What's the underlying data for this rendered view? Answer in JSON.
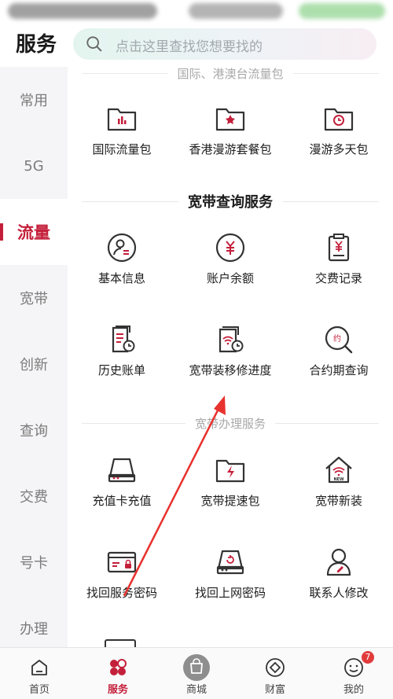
{
  "header": {
    "title": "服务",
    "search_placeholder": "点击这里查找您想要找的"
  },
  "sidebar": {
    "items": [
      {
        "label": "常用"
      },
      {
        "label": "5G"
      },
      {
        "label": "流量",
        "active": true
      },
      {
        "label": "宽带"
      },
      {
        "label": "创新"
      },
      {
        "label": "查询"
      },
      {
        "label": "交费"
      },
      {
        "label": "号卡"
      },
      {
        "label": "办理"
      }
    ]
  },
  "sections": {
    "roaming": {
      "title": "国际、港澳台流量包",
      "items": [
        {
          "label": "国际流量包",
          "icon": "folder-chart-icon"
        },
        {
          "label": "香港漫游套餐包",
          "icon": "folder-flower-icon"
        },
        {
          "label": "漫游多天包",
          "icon": "folder-clock-icon"
        }
      ]
    },
    "broadband_query": {
      "title": "宽带查询服务",
      "items": [
        {
          "label": "基本信息",
          "icon": "user-info-icon"
        },
        {
          "label": "账户余额",
          "icon": "yen-coin-icon"
        },
        {
          "label": "交费记录",
          "icon": "clipboard-yen-icon"
        },
        {
          "label": "历史账单",
          "icon": "bill-clock-icon"
        },
        {
          "label": "宽带装移修进度",
          "icon": "wifi-clock-icon"
        },
        {
          "label": "合约期查询",
          "icon": "contract-search-icon"
        }
      ]
    },
    "broadband_service": {
      "title": "宽带办理服务",
      "items": [
        {
          "label": "充值卡充值",
          "icon": "router-icon"
        },
        {
          "label": "宽带提速包",
          "icon": "folder-bolt-icon"
        },
        {
          "label": "宽带新装",
          "icon": "house-wifi-icon"
        },
        {
          "label": "找回服务密码",
          "icon": "card-lock-icon"
        },
        {
          "label": "找回上网密码",
          "icon": "router-refresh-icon"
        },
        {
          "label": "联系人修改",
          "icon": "contact-edit-icon"
        }
      ]
    }
  },
  "tabbar": {
    "items": [
      {
        "label": "首页",
        "icon": "home-icon"
      },
      {
        "label": "服务",
        "icon": "service-icon",
        "active": true
      },
      {
        "label": "商城",
        "icon": "shop-bag-icon"
      },
      {
        "label": "财富",
        "icon": "diamond-icon"
      },
      {
        "label": "我的",
        "icon": "profile-icon",
        "badge": "7"
      }
    ]
  },
  "colors": {
    "accent": "#c41f3a",
    "annotation_arrow": "#e8322e"
  }
}
